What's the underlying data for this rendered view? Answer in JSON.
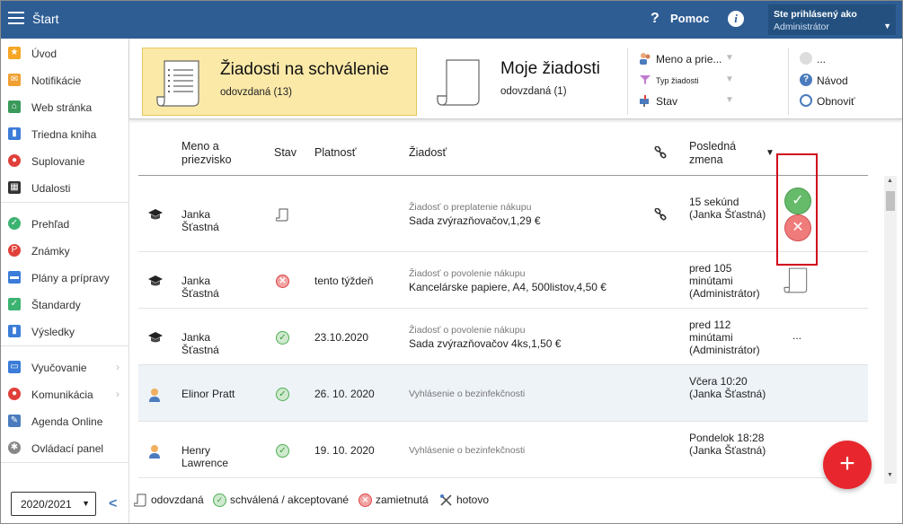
{
  "header": {
    "app_title": "Štart",
    "help_label": "Pomoc",
    "user_title": "Ste prihlásený ako",
    "user_name": "Administrátor"
  },
  "sidebar": {
    "items": [
      {
        "label": "Úvod",
        "icon": "star-icon",
        "color": "#f5a623"
      },
      {
        "label": "Notifikácie",
        "icon": "envelope-icon",
        "color": "#f0a030"
      },
      {
        "label": "Web stránka",
        "icon": "house-icon",
        "color": "#3a9a5b"
      },
      {
        "label": "Triedna kniha",
        "icon": "book-icon",
        "color": "#3b7dd8"
      },
      {
        "label": "Suplovanie",
        "icon": "person-icon",
        "color": "#e0403a"
      },
      {
        "label": "Udalosti",
        "icon": "calendar-icon",
        "color": "#333333"
      },
      {
        "label": "Prehľad",
        "icon": "check-circle-icon",
        "color": "#3cb371"
      },
      {
        "label": "Známky",
        "icon": "grades-icon",
        "color": "#e0403a"
      },
      {
        "label": "Plány a prípravy",
        "icon": "briefcase-icon",
        "color": "#3b7dd8"
      },
      {
        "label": "Štandardy",
        "icon": "shield-icon",
        "color": "#3cb371"
      },
      {
        "label": "Výsledky",
        "icon": "bar-chart-icon",
        "color": "#3b7dd8"
      },
      {
        "label": "Vyučovanie",
        "icon": "open-book-icon",
        "color": "#3b7dd8"
      },
      {
        "label": "Komunikácia",
        "icon": "chat-icon",
        "color": "#e0403a"
      },
      {
        "label": "Agenda Online",
        "icon": "pen-icon",
        "color": "#4a7bbd"
      },
      {
        "label": "Ovládací panel",
        "icon": "gear-icon",
        "color": "#888888"
      }
    ],
    "year": "2020/2021"
  },
  "tabs": [
    {
      "title": "Žiadosti na schválenie",
      "sub": "odovzdaná (13)"
    },
    {
      "title": "Moje žiadosti",
      "sub": "odovzdaná (1)"
    }
  ],
  "filters": {
    "name": "Meno a prie...",
    "type": "Typ žiadosti",
    "state": "Stav"
  },
  "actions": {
    "more": "...",
    "guide": "Návod",
    "refresh": "Obnoviť"
  },
  "table": {
    "headers": {
      "name": "Meno a priezvisko",
      "state": "Stav",
      "validity": "Platnosť",
      "request": "Žiadosť",
      "last_change": "Posledná zmena"
    },
    "rows": [
      {
        "who": "student",
        "name": "Janka Šťastná",
        "status": "submitted",
        "validity": "",
        "type": "Žiadosť o preplatenie nákupu",
        "desc": "Sada zvýrazňovačov,1,29 €",
        "link": true,
        "change": "15 sekúnd (Janka Šťastná)",
        "extra": "approve-reject"
      },
      {
        "who": "student",
        "name": "Janka Šťastná",
        "status": "rejected",
        "validity": "tento týždeň",
        "type": "Žiadosť o povolenie nákupu",
        "desc": "Kancelárske papiere, A4, 500listov,4,50 €",
        "link": false,
        "change": "pred 105 minútami (Administrátor)",
        "extra": "doc"
      },
      {
        "who": "student",
        "name": "Janka Šťastná",
        "status": "approved",
        "validity": "23.10.2020",
        "type": "Žiadosť o povolenie nákupu",
        "desc": "Sada zvýrazňovačov 4ks,1,50 €",
        "link": false,
        "change": "pred 112 minútami (Administrátor)",
        "extra": "dots"
      },
      {
        "who": "adult",
        "name": "Elinor Pratt",
        "status": "approved",
        "validity": "26. 10. 2020",
        "type": "Vyhlásenie o bezinfekčnosti",
        "desc": "",
        "link": false,
        "change": "Včera 10:20 (Janka Šťastná)",
        "extra": ""
      },
      {
        "who": "adult",
        "name": "Henry Lawrence",
        "status": "approved",
        "validity": "19. 10. 2020",
        "type": "Vyhlásenie o bezinfekčnosti",
        "desc": "",
        "link": false,
        "change": "Pondelok 18:28 (Janka Šťastná)",
        "extra": ""
      }
    ]
  },
  "legend": {
    "submitted": "odovzdaná",
    "approved": "schválená / akceptované",
    "rejected": "zamietnutá",
    "done": "hotovo"
  },
  "colors": {
    "topbar": "#2e5d94",
    "active_tab": "#fbe9a8",
    "approve": "#66bb6a",
    "reject": "#ef7b7b",
    "fab": "#e8262d",
    "highlight_box": "#d0021b"
  }
}
